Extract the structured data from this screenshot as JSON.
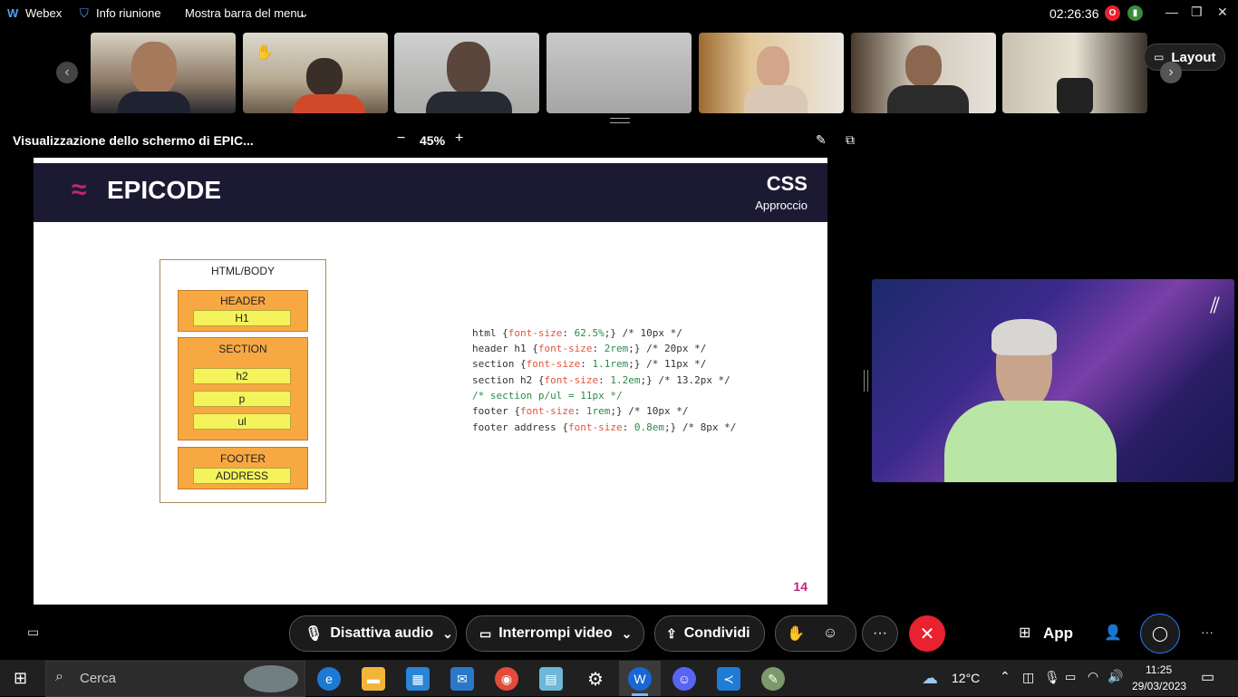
{
  "topbar": {
    "app_name": "Webex",
    "meeting_info": "Info riunione",
    "menu_toggle": "Mostra barra del menu",
    "clock": "02:26:36",
    "record_badge": "O"
  },
  "layout_button": "Layout",
  "share": {
    "title": "Visualizzazione dello schermo di EPIC...",
    "zoom": "45%",
    "zoom_minus": "−",
    "zoom_plus": "+"
  },
  "slide": {
    "logo": "EPICODE",
    "heading": "CSS",
    "subheading": "Approccio",
    "page_number": "14",
    "diagram": {
      "outer": "HTML/BODY",
      "header": "HEADER",
      "h1": "H1",
      "section": "SECTION",
      "h2": "h2",
      "p": "p",
      "ul": "ul",
      "footer": "FOOTER",
      "address": "ADDRESS"
    },
    "code": [
      {
        "sel": "html {",
        "prop": "font-size",
        "val": "62.5%",
        "rest": ";} /* 10px */"
      },
      {
        "sel": "header h1 {",
        "prop": "font-size",
        "val": "2rem",
        "rest": ";} /* 20px */"
      },
      {
        "sel": "section {",
        "prop": "font-size",
        "val": "1.1rem",
        "rest": ";} /* 11px */"
      },
      {
        "sel": "section h2 {",
        "prop": "font-size",
        "val": "1.2em",
        "rest": ";} /* 13.2px */"
      },
      {
        "sel": "/* section p/ul = 11px */",
        "prop": "",
        "val": "",
        "rest": ""
      },
      {
        "sel": "footer {",
        "prop": "font-size",
        "val": "1rem",
        "rest": ";} /* 10px */"
      },
      {
        "sel": "footer address {",
        "prop": "font-size",
        "val": "0.8em",
        "rest": ";} /* 8px */"
      }
    ]
  },
  "controls": {
    "audio": "Disattiva audio",
    "video": "Interrompi video",
    "share": "Condividi",
    "apps": "App",
    "more": "···"
  },
  "taskbar": {
    "search": "Cerca",
    "weather": "12°C",
    "time": "11:25",
    "date": "29/03/2023"
  },
  "colors": {
    "accent_red": "#e8222e",
    "slide_header": "#1c1a33",
    "epicode_pink": "#c2237d"
  }
}
